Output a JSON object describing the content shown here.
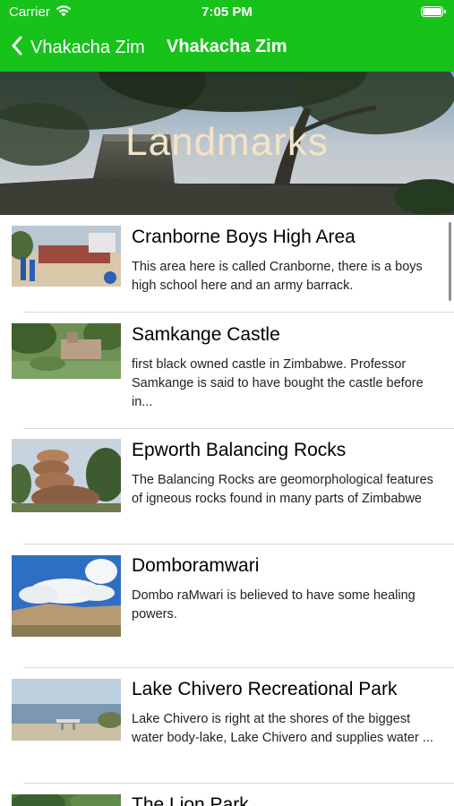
{
  "status_bar": {
    "carrier": "Carrier",
    "time": "7:05 PM"
  },
  "nav": {
    "back_label": "Vhakacha Zim",
    "title": "Vhakacha Zim",
    "bar_color": "#17c21a"
  },
  "banner": {
    "title": "Landmarks"
  },
  "landmarks": [
    {
      "title": "Cranborne Boys High Area",
      "description": "This area here is called Cranborne, there is a boys high school here and an army barrack."
    },
    {
      "title": "Samkange Castle",
      "description": "first black owned castle in Zimbabwe. Professor Samkange is said to have bought the castle before in..."
    },
    {
      "title": "Epworth Balancing Rocks",
      "description": "The Balancing Rocks are geomorphological features of igneous rocks found in many parts of Zimbabwe"
    },
    {
      "title": "Domboramwari",
      "description": "Dombo raMwari is believed to have some healing powers."
    },
    {
      "title": "Lake Chivero Recreational Park",
      "description": "Lake Chivero is right at the shores of the biggest water body-lake, Lake Chivero and supplies water ..."
    },
    {
      "title": "The Lion Park",
      "description": ""
    }
  ]
}
